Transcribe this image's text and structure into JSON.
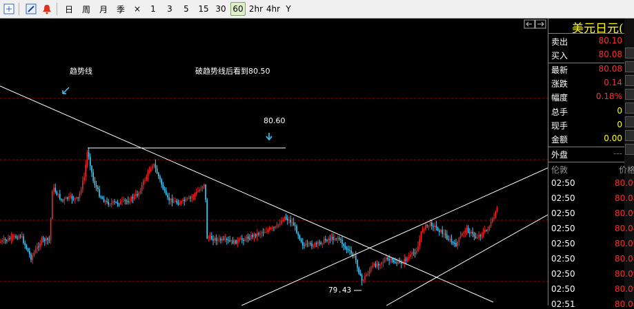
{
  "toolbar": {
    "icons": [
      "chart-edit-icon",
      "draw-pen-icon",
      "alarm-bell-icon"
    ],
    "periods": [
      "日",
      "周",
      "月",
      "季",
      "×",
      "1",
      "3",
      "5",
      "15",
      "30",
      "60",
      "2hr",
      "4hr",
      "Y"
    ],
    "active_period": "60"
  },
  "chart": {
    "annotations": {
      "trendline_label": "趋势线",
      "break_note": "破趋势线后看到80.50",
      "target_price": "80.60",
      "low_price": "79.43"
    },
    "colors": {
      "up": "#ff2020",
      "down": "#40d0ff",
      "background": "#000000",
      "trendline": "#ffffff",
      "grid": "#a00000"
    }
  },
  "panel": {
    "title": "美元日元(",
    "rows": [
      {
        "label": "卖出",
        "value": "80.10"
      },
      {
        "label": "买入",
        "value": "80.08"
      },
      {
        "label": "最新",
        "value": "80.08"
      },
      {
        "label": "涨跌",
        "value": "0.14"
      },
      {
        "label": "幅度",
        "value": "0.18%"
      },
      {
        "label": "总手",
        "value": "0"
      },
      {
        "label": "现手",
        "value": "0"
      },
      {
        "label": "金额",
        "value": "0.00"
      },
      {
        "label": "外盘",
        "value": "---"
      }
    ],
    "ticks_header": {
      "col1": "伦敦",
      "col2": "价格"
    },
    "ticks": [
      {
        "time": "02:50",
        "price": "80.09"
      },
      {
        "time": "02:50",
        "price": "80.08"
      },
      {
        "time": "02:50",
        "price": "80.09"
      },
      {
        "time": "02:50",
        "price": "80.08"
      },
      {
        "time": "02:50",
        "price": "80.09"
      },
      {
        "time": "02:50",
        "price": "80.08"
      },
      {
        "time": "02:50",
        "price": "80.09"
      },
      {
        "time": "02:50",
        "price": "80.09"
      },
      {
        "time": "02:51",
        "price": "80.08"
      }
    ]
  }
}
